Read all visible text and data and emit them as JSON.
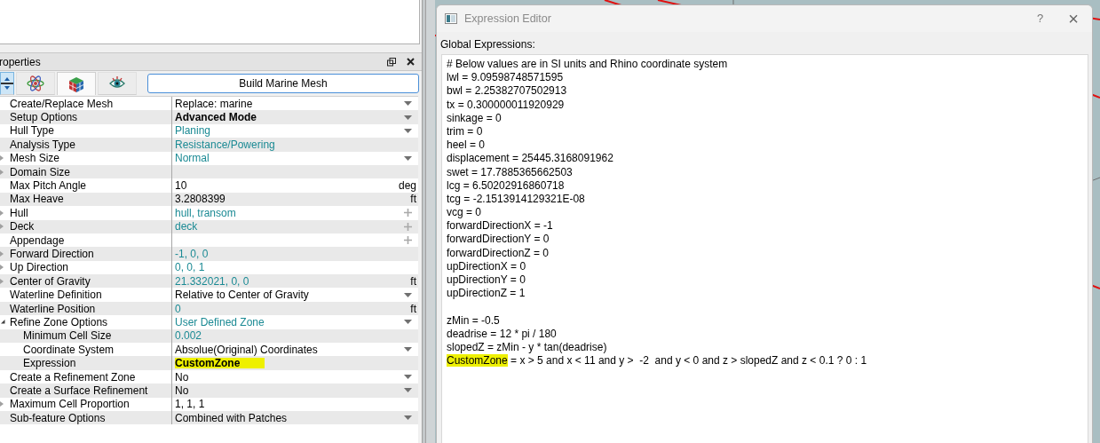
{
  "properties": {
    "title": "roperties",
    "tools": [
      {
        "kind": "arrows",
        "selected": false,
        "highlighted": true
      },
      {
        "kind": "atom",
        "selected": false,
        "highlighted": false
      },
      {
        "kind": "cube",
        "selected": true,
        "highlighted": false
      },
      {
        "kind": "eye",
        "selected": false,
        "highlighted": false
      }
    ],
    "build_button": "Build Marine Mesh",
    "rows": [
      {
        "label": "Create/Replace Mesh",
        "value": "Replace: marine",
        "kind": "plain",
        "dropdown": true
      },
      {
        "label": "Setup Options",
        "value": "Advanced Mode",
        "kind": "bold",
        "dropdown": true
      },
      {
        "label": "Hull Type",
        "value": "Planing",
        "kind": "linked",
        "dropdown": true
      },
      {
        "label": "Analysis Type",
        "value": "Resistance/Powering",
        "kind": "linked"
      },
      {
        "label": "Mesh Size",
        "value": "Normal",
        "kind": "linked",
        "dropdown": true,
        "expanded": false
      },
      {
        "label": "Domain Size",
        "expanded": false
      },
      {
        "label": "Max Pitch Angle",
        "value": "10",
        "kind": "plain",
        "unit": "deg"
      },
      {
        "label": "Max Heave",
        "value": "3.2808399",
        "kind": "plain",
        "unit": "ft"
      },
      {
        "label": "Hull",
        "value": "hull, transom",
        "kind": "linked",
        "addable": true,
        "expanded": false
      },
      {
        "label": "Deck",
        "value": "deck",
        "kind": "linked",
        "addable": true,
        "expanded": false
      },
      {
        "label": "Appendage",
        "addable": true
      },
      {
        "label": "Forward Direction",
        "value": "-1, 0, 0",
        "kind": "linked",
        "expanded": false
      },
      {
        "label": "Up Direction",
        "value": "0, 0, 1",
        "kind": "linked",
        "expanded": false
      },
      {
        "label": "Center of Gravity",
        "value": "21.332021, 0, 0",
        "kind": "linked",
        "unit": "ft",
        "expanded": false
      },
      {
        "label": "Waterline Definition",
        "value": "Relative to Center of Gravity",
        "kind": "plain",
        "dropdown": true
      },
      {
        "label": "Waterline Position",
        "value": "0",
        "kind": "linked",
        "unit": "ft"
      },
      {
        "label": "Refine Zone Options",
        "value": "User Defined Zone",
        "kind": "linked",
        "dropdown": true,
        "expanded": true,
        "children": [
          {
            "label": "Minimum Cell Size",
            "value": "0.002",
            "kind": "linked"
          },
          {
            "label": "Coordinate System",
            "value": "Absolue(Original) Coordinates",
            "kind": "plain",
            "dropdown": true
          },
          {
            "label": "Expression",
            "value": "CustomZone",
            "kind": "marked"
          }
        ]
      },
      {
        "label": "Create a Refinement Zone",
        "value": "No",
        "kind": "plain",
        "dropdown": true
      },
      {
        "label": "Create a Surface Refinement",
        "value": "No",
        "kind": "plain",
        "dropdown": true
      },
      {
        "label": "Maximum Cell Proportion",
        "value": "1, 1, 1",
        "kind": "plain",
        "expanded": false
      },
      {
        "label": "Sub-feature Options",
        "value": "Combined with Patches",
        "kind": "plain",
        "dropdown": true
      }
    ]
  },
  "dialog": {
    "title": "Expression Editor",
    "help": "?",
    "close": "×",
    "section_label": "Global Expressions:",
    "lines": [
      {
        "kind": "text",
        "text": "# Below values are in SI units and Rhino coordinate system"
      },
      {
        "kind": "text",
        "text": "lwl = 9.09598748571595"
      },
      {
        "kind": "text",
        "text": "bwl = 2.25382707502913"
      },
      {
        "kind": "text",
        "text": "tx = 0.300000011920929"
      },
      {
        "kind": "text",
        "text": "sinkage = 0"
      },
      {
        "kind": "text",
        "text": "trim = 0"
      },
      {
        "kind": "text",
        "text": "heel = 0"
      },
      {
        "kind": "text",
        "text": "displacement = 25445.3168091962"
      },
      {
        "kind": "text",
        "text": "swet = 17.7885365662503"
      },
      {
        "kind": "text",
        "text": "lcg = 6.50202916860718"
      },
      {
        "kind": "text",
        "text": "tcg = -2.1513914129321E-08"
      },
      {
        "kind": "text",
        "text": "vcg = 0"
      },
      {
        "kind": "text",
        "text": "forwardDirectionX = -1"
      },
      {
        "kind": "text",
        "text": "forwardDirectionY = 0"
      },
      {
        "kind": "text",
        "text": "forwardDirectionZ = 0"
      },
      {
        "kind": "text",
        "text": "upDirectionX = 0"
      },
      {
        "kind": "text",
        "text": "upDirectionY = 0"
      },
      {
        "kind": "text",
        "text": "upDirectionZ = 1"
      },
      {
        "kind": "blank"
      },
      {
        "kind": "text",
        "text": "zMin = -0.5"
      },
      {
        "kind": "text",
        "text": "deadrise = 12 * pi / 180"
      },
      {
        "kind": "text",
        "text": "slopedZ = zMin - y * tan(deadrise)"
      },
      {
        "kind": "text",
        "highlight": "CustomZone",
        "text": " = x > 5 and x < 11 and y >  -2  and y < 0 and z > slopedZ and z < 0.1 ? 0 : 1"
      }
    ]
  }
}
